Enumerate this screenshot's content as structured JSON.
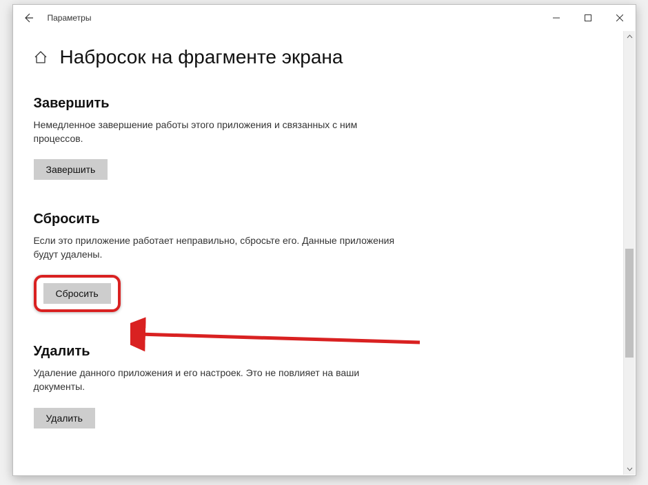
{
  "window": {
    "title": "Параметры"
  },
  "page": {
    "title": "Набросок на фрагменте экрана"
  },
  "sections": {
    "terminate": {
      "title": "Завершить",
      "desc": "Немедленное завершение работы этого приложения и связанных с ним процессов.",
      "button": "Завершить"
    },
    "reset": {
      "title": "Сбросить",
      "desc": "Если это приложение работает неправильно, сбросьте его. Данные приложения будут удалены.",
      "button": "Сбросить"
    },
    "uninstall": {
      "title": "Удалить",
      "desc": "Удаление данного приложения и его настроек. Это не повлияет на ваши документы.",
      "button": "Удалить"
    }
  },
  "annotation": {
    "color": "#d92121"
  }
}
